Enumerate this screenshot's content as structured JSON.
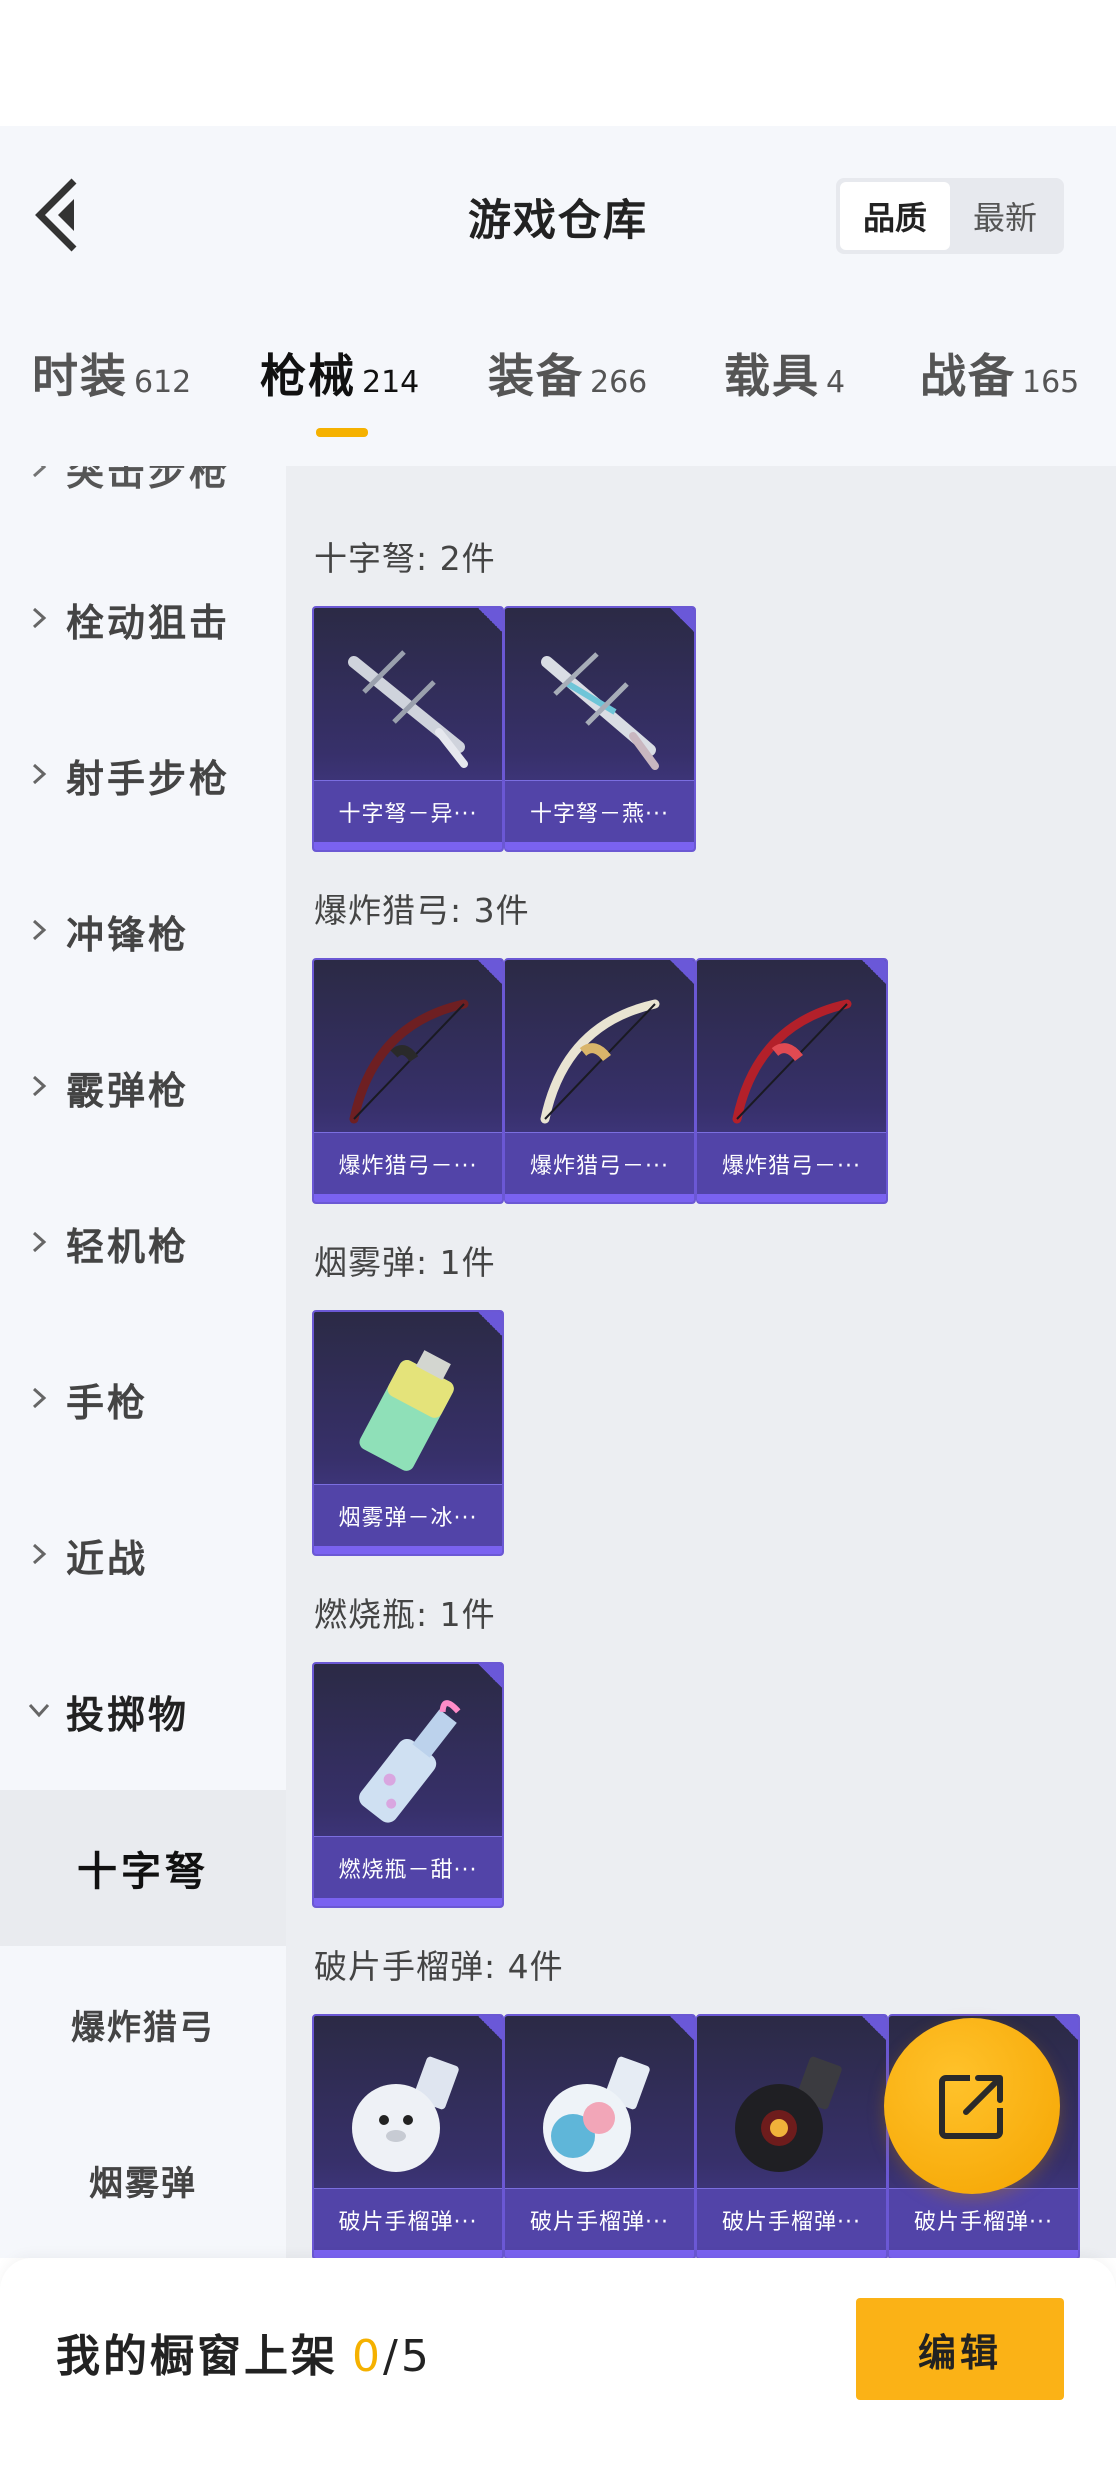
{
  "header": {
    "title": "游戏仓库",
    "sort_options": [
      "品质",
      "最新"
    ],
    "active_sort": "品质"
  },
  "tabs": [
    {
      "label": "时装",
      "count": "612"
    },
    {
      "label": "枪械",
      "count": "214"
    },
    {
      "label": "装备",
      "count": "266"
    },
    {
      "label": "载具",
      "count": "4"
    },
    {
      "label": "战备",
      "count": "165"
    }
  ],
  "active_tab": "枪械",
  "sidebar": {
    "categories": [
      "突击步枪",
      "栓动狙击",
      "射手步枪",
      "冲锋枪",
      "霰弹枪",
      "轻机枪",
      "手枪",
      "近战",
      "投掷物"
    ],
    "expanded_category": "投掷物",
    "subcategories": [
      "十字弩",
      "爆炸猎弓",
      "烟雾弹"
    ],
    "active_subcategory": "十字弩"
  },
  "sections": [
    {
      "title": "十字弩: 2件",
      "items": [
        "十字弩－异···",
        "十字弩－燕···"
      ]
    },
    {
      "title": "爆炸猎弓: 3件",
      "items": [
        "爆炸猎弓－···",
        "爆炸猎弓－···",
        "爆炸猎弓－···"
      ]
    },
    {
      "title": "烟雾弹: 1件",
      "items": [
        "烟雾弹－冰···"
      ]
    },
    {
      "title": "燃烧瓶: 1件",
      "items": [
        "燃烧瓶－甜···"
      ]
    },
    {
      "title": "破片手榴弹: 4件",
      "items": [
        "破片手榴弹···",
        "破片手榴弹···",
        "破片手榴弹···",
        "破片手榴弹···"
      ]
    }
  ],
  "footer": {
    "showcase_label": "我的橱窗上架",
    "showcase_current": "0",
    "showcase_total": "/5",
    "edit_label": "编辑"
  },
  "icons": [
    "back-icon",
    "chevron-right-icon",
    "chevron-down-icon",
    "share-icon"
  ],
  "colors": {
    "accent": "#f5b100",
    "card_border": "#6b58d4",
    "card_bg": "#37306a"
  }
}
